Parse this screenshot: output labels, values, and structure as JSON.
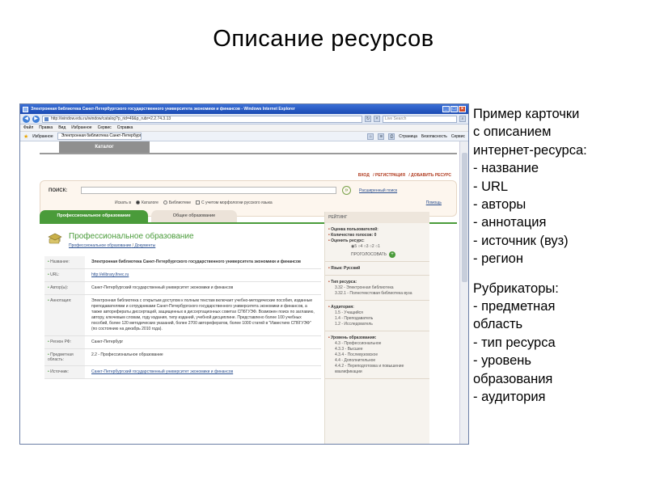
{
  "slide": {
    "title": "Описание ресурсов"
  },
  "browser": {
    "window_title": "Электронная библиотека Санкт-Петербургского государственного университета экономики и финансов - Windows Internet Explorer",
    "url": "http://window.edu.ru/window/catalog?p_rid=49&p_rubr=2.2.74.3.13",
    "search_placeholder": "Live Search",
    "menu": [
      "Файл",
      "Правка",
      "Вид",
      "Избранное",
      "Сервис",
      "Справка"
    ],
    "favorites_label": "Избранное",
    "tab_title": "Электронная библиотека Санкт-Петербургского г...",
    "toolbar_right": [
      "Страница",
      "Безопасность",
      "Сервис"
    ]
  },
  "page": {
    "catalog_tab": "Каталог",
    "top_links": [
      "ВХОД",
      "/ РЕГИСТРАЦИЯ",
      "/ ДОБАВИТЬ РЕСУРС"
    ],
    "search": {
      "label": "ПОИСК:",
      "advanced": "Расширенный поиск",
      "search_in": "Искать в",
      "opt_catalog": "Каталоге",
      "opt_library": "Библиотеке",
      "morph": "С учетом морфологии русского языка",
      "help": "Помощь"
    },
    "edu_tabs": {
      "active": "Профессиональное образование",
      "inactive": "Общее образование"
    },
    "card": {
      "heading": "Профессиональное образование",
      "crumb_1": "Профессиональное образование",
      "crumb_sep": " / ",
      "crumb_2": "Документы",
      "rows": [
        {
          "k": "Название:",
          "v": "Электронная библиотека Санкт-Петербургского государственного университета экономики и финансов",
          "style": "bold"
        },
        {
          "k": "URL:",
          "v": "http://elibrary.finec.ru",
          "style": "link"
        },
        {
          "k": "Автор(ы):",
          "v": "Санкт-Петербургский государственный университет экономики и финансов",
          "style": ""
        },
        {
          "k": "Аннотация:",
          "v": "Электронная библиотека с открытым доступом к полным текстам включает учебно-методические пособия, изданные преподавателями и сотрудниками Санкт-Петербургского государственного университета экономики и финансов, а также авторефераты диссертаций, защищенных в диссертационных советах СПбГУЭФ. Возможен поиск по заглавию, автору, ключевым словам, году издания, типу изданий, учебной дисциплине. Представлено более 100 учебных пособий, более 120 методических указаний, более 2700 авторефератов, более 1000 статей в \"Известиях СПбГУЭФ\" (по состоянию на декабрь 2010 года).",
          "style": ""
        },
        {
          "k": "Регион РФ:",
          "v": "Санкт-Петербург",
          "style": ""
        },
        {
          "k": "Предметная область:",
          "v": "2.2 - Профессиональное образование",
          "style": ""
        },
        {
          "k": "Источник:",
          "v": "Санкт-Петербургский государственный университет экономики и финансов",
          "style": "link"
        }
      ]
    },
    "rating": {
      "header": "РЕЙТИНГ",
      "user_rating": "Оценка пользователей:",
      "votes": "Количество голосов: 0",
      "rate_label": "Оценить ресурс:",
      "scale": "◉5 ○4 ○3 ○2 ○1",
      "vote_button": "ПРОГОЛОСОВАТЬ",
      "language": "Язык: Русский",
      "type_title": "Тип ресурса:",
      "type_items": [
        "3.32 - Электронная библиотека",
        "3.32.1 - Полнотекстовая библиотека вуза"
      ],
      "audience_title": "Аудитория:",
      "audience_items": [
        "1.5 - Учащийся",
        "1.4 - Преподаватель",
        "1.2 - Исследователь"
      ],
      "level_title": "Уровень образования:",
      "level_items": [
        "4.3 - Профессиональное",
        "4.3.3 - Высшее",
        "4.3.4 - Послевузовское",
        "4.4 - Дополнительное",
        "4.4.2 - Переподготовка и повышение квалификации"
      ]
    }
  },
  "notes": {
    "lines_1": [
      "Пример карточки",
      " с описанием",
      " интернет-ресурса:",
      "- название",
      "- URL",
      "- авторы",
      "- аннотация",
      "- источник (вуз)",
      "- регион"
    ],
    "lines_2": [
      " Рубрикаторы:",
      "- предметная",
      "  область",
      "- тип ресурса",
      "- уровень",
      "  образования",
      "- аудитория"
    ]
  }
}
